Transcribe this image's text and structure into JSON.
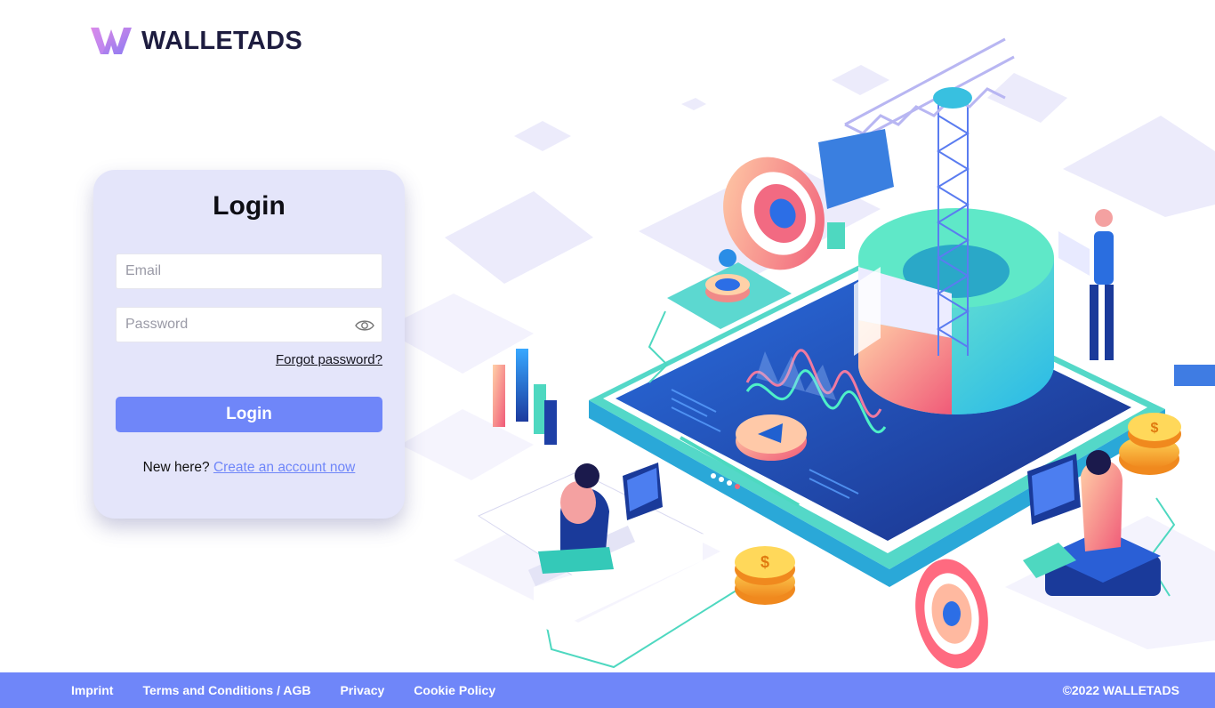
{
  "brand": {
    "name": "WALLETADS"
  },
  "login": {
    "title": "Login",
    "email_placeholder": "Email",
    "password_placeholder": "Password",
    "forgot_label": "Forgot password?",
    "submit_label": "Login",
    "signup_prompt": "New here?",
    "signup_link": "Create an account now"
  },
  "footer": {
    "links": [
      "Imprint",
      "Terms and Conditions / AGB",
      "Privacy",
      "Cookie Policy"
    ],
    "copyright": "©2022 WALLETADS"
  },
  "colors": {
    "accent": "#6f86f9",
    "card_bg": "#e4e5fa",
    "logo_gradient": [
      "#8b7bf3",
      "#e48ae4"
    ],
    "illustration_navy": "#1e3fa6",
    "illustration_teal": "#5ce6c6",
    "illustration_coral": "#f06878"
  },
  "icons": [
    "walletads-logo-icon",
    "eye-icon"
  ]
}
